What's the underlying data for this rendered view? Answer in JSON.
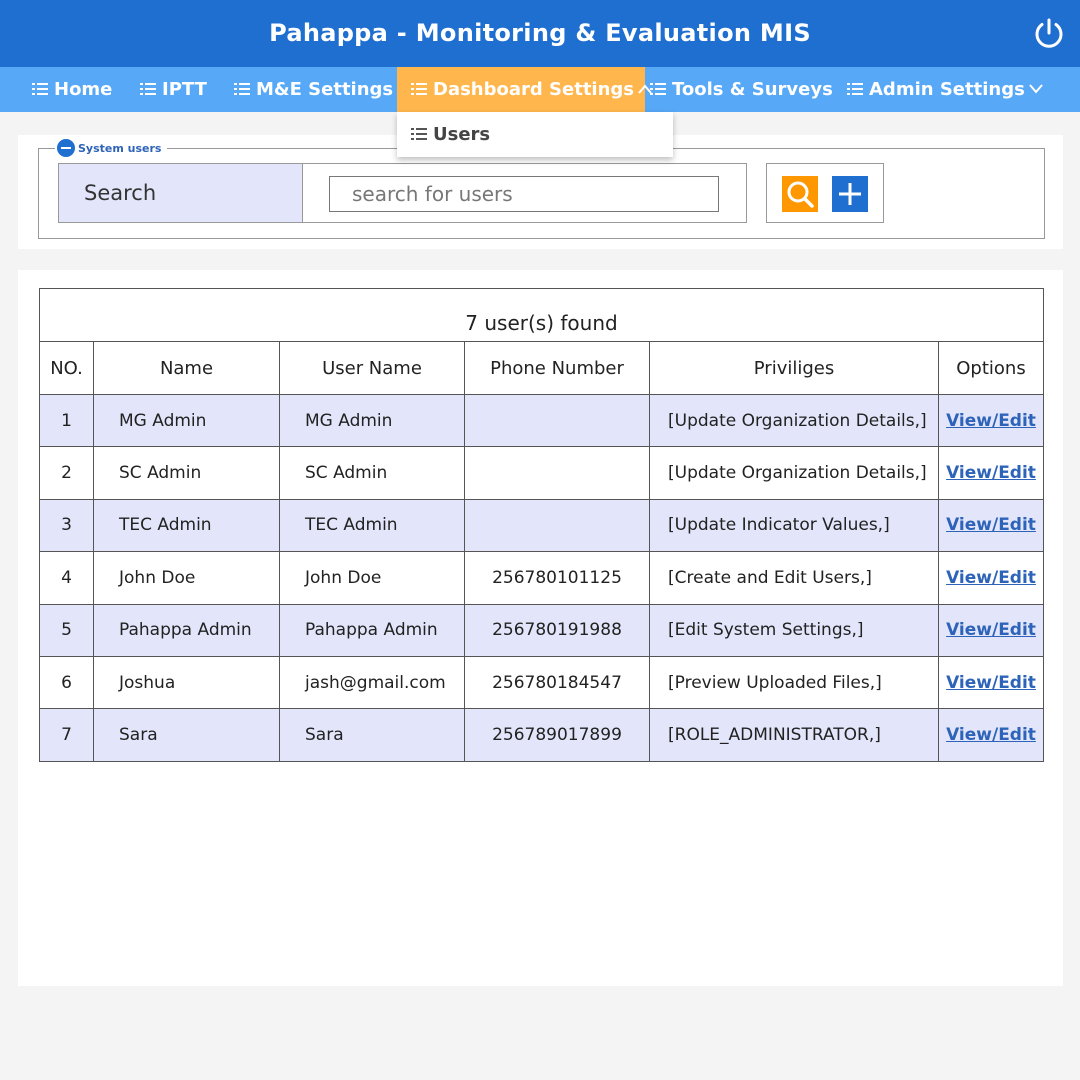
{
  "app": {
    "title": "Pahappa - Monitoring & Evaluation MIS"
  },
  "colors": {
    "header": "#1f6fd1",
    "nav": "#57a8f7",
    "nav_active": "#ffb64d",
    "row_alt": "#e3e6fa",
    "link": "#2d63b8",
    "search_button": "#ff9800",
    "add_button": "#1f6fd1"
  },
  "nav": {
    "items": [
      {
        "label": "Home",
        "icon": "list-icon"
      },
      {
        "label": "IPTT",
        "icon": "list-icon"
      },
      {
        "label": "M&E Settings",
        "icon": "list-icon"
      },
      {
        "label": "Dashboard Settings",
        "icon": "list-icon",
        "active": true,
        "chevron": "chevron-up-icon"
      },
      {
        "label": "Tools & Surveys",
        "icon": "list-icon"
      },
      {
        "label": "Admin Settings",
        "icon": "list-icon",
        "chevron": "chevron-down-icon"
      }
    ],
    "dropdown": {
      "items": [
        {
          "label": "Users",
          "icon": "list-icon"
        }
      ]
    }
  },
  "search_panel": {
    "legend": "System users",
    "label": "Search",
    "placeholder": "search for users",
    "value": ""
  },
  "users_table": {
    "caption": "7 user(s) found",
    "columns": [
      "NO.",
      "Name",
      "User Name",
      "Phone Number",
      "Priviliges",
      "Options"
    ],
    "rows": [
      {
        "no": "1",
        "name": "MG Admin",
        "username": "MG Admin",
        "phone": "",
        "privileges": "[Update Organization Details,]",
        "option": "View/Edit"
      },
      {
        "no": "2",
        "name": "SC Admin",
        "username": "SC Admin",
        "phone": "",
        "privileges": "[Update Organization Details,]",
        "option": "View/Edit"
      },
      {
        "no": "3",
        "name": "TEC Admin",
        "username": "TEC Admin",
        "phone": "",
        "privileges": "[Update Indicator Values,]",
        "option": "View/Edit"
      },
      {
        "no": "4",
        "name": "John Doe",
        "username": "John Doe",
        "phone": "256780101125",
        "privileges": "[Create and Edit Users,]",
        "option": "View/Edit"
      },
      {
        "no": "5",
        "name": "Pahappa Admin",
        "username": "Pahappa Admin",
        "phone": "256780191988",
        "privileges": "[Edit System Settings,]",
        "option": "View/Edit"
      },
      {
        "no": "6",
        "name": "Joshua",
        "username": "jash@gmail.com",
        "phone": "256780184547",
        "privileges": "[Preview Uploaded Files,]",
        "option": "View/Edit"
      },
      {
        "no": "7",
        "name": "Sara",
        "username": "Sara",
        "phone": "256789017899",
        "privileges": "[ROLE_ADMINISTRATOR,]",
        "option": "View/Edit"
      }
    ]
  }
}
